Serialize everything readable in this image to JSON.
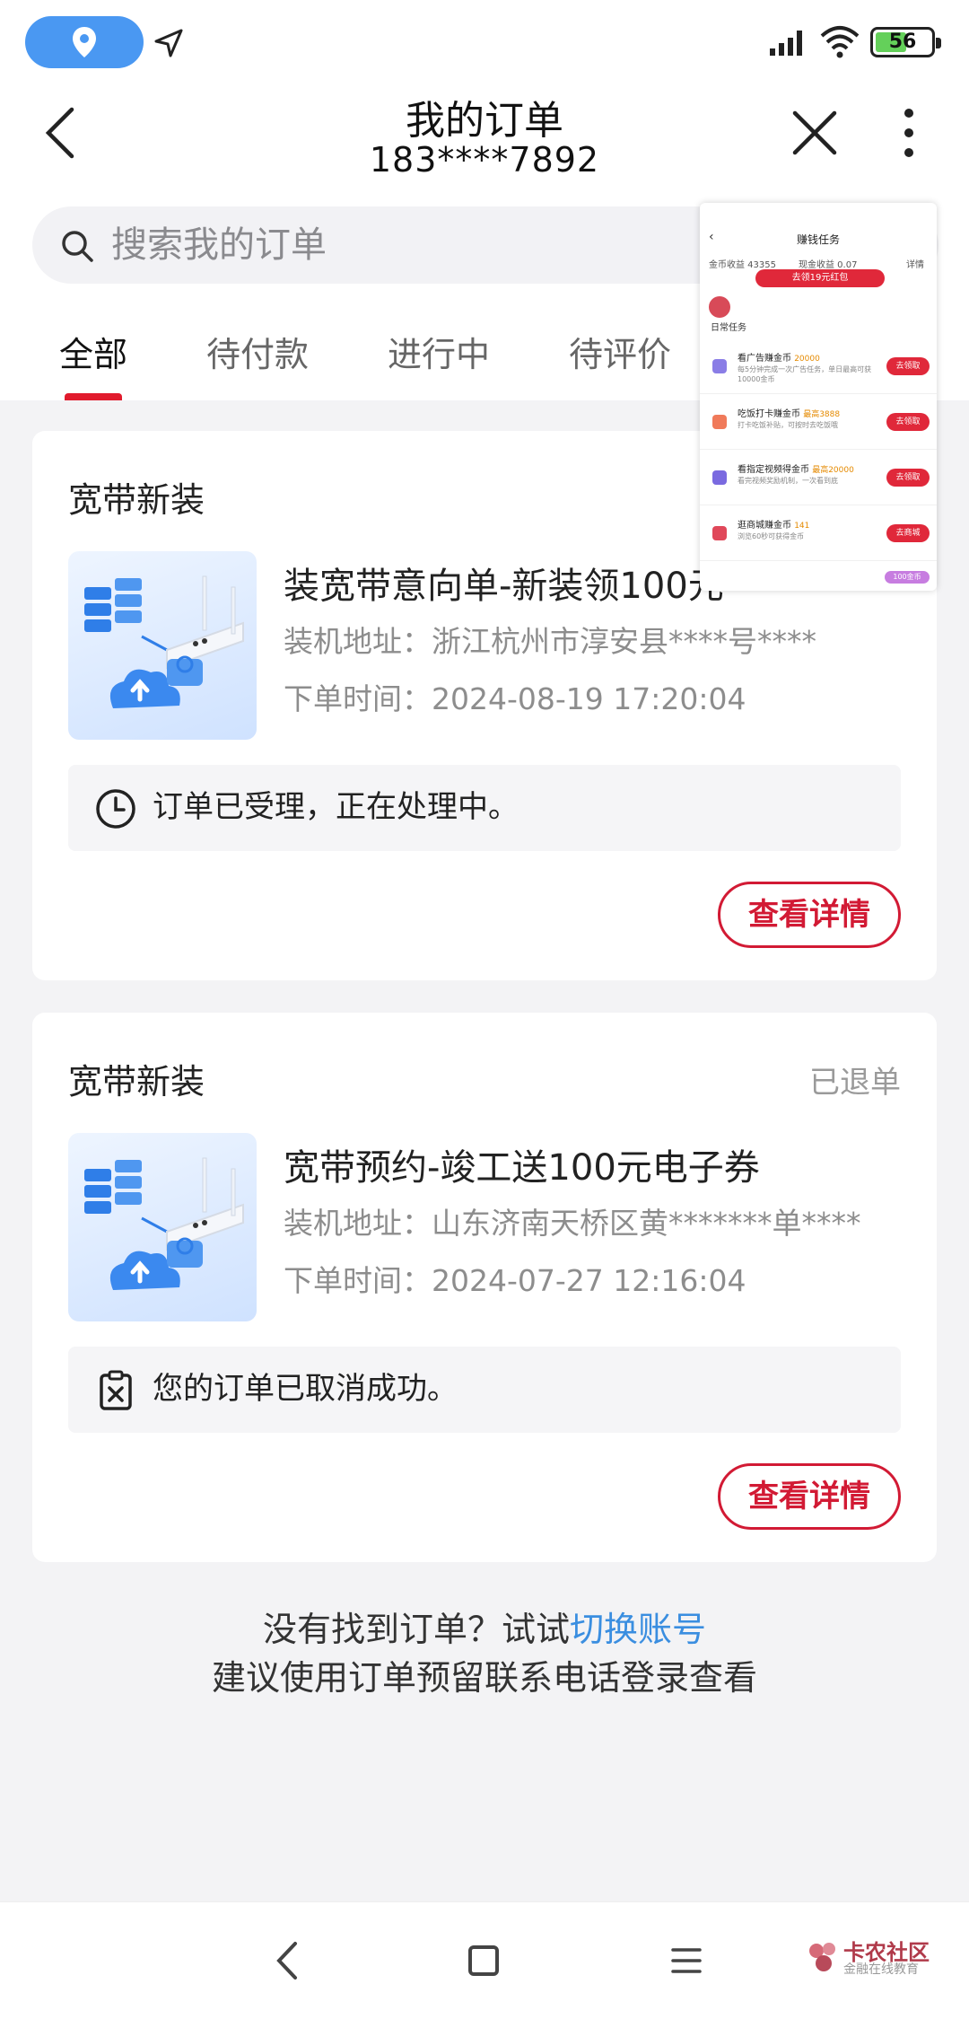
{
  "status_bar": {
    "battery": "56",
    "battery_level": 0.56
  },
  "header": {
    "title": "我的订单",
    "phone": "183****7892"
  },
  "search": {
    "placeholder": "搜索我的订单"
  },
  "tabs": [
    {
      "label": "全部",
      "active": true
    },
    {
      "label": "待付款",
      "active": false
    },
    {
      "label": "进行中",
      "active": false
    },
    {
      "label": "待评价",
      "active": false
    }
  ],
  "orders": [
    {
      "category": "宽带新装",
      "status": "",
      "product_name": "装宽带意向单-新装领100元",
      "address_label": "装机地址：",
      "address": "浙江杭州市淳安县****号****",
      "time_label": "下单时间：",
      "time": "2024-08-19 17:20:04",
      "notice": "订单已受理，正在处理中。",
      "notice_icon": "clock-icon",
      "detail_label": "查看详情"
    },
    {
      "category": "宽带新装",
      "status": "已退单",
      "product_name": "宽带预约-竣工送100元电子券",
      "address_label": "装机地址：",
      "address": "山东济南天桥区黄*******单****",
      "time_label": "下单时间：",
      "time": "2024-07-27 12:16:04",
      "notice": "您的订单已取消成功。",
      "notice_icon": "clipboard-x-icon",
      "detail_label": "查看详情"
    }
  ],
  "footer_hint": {
    "line1_prefix": "没有找到订单？试试",
    "line1_link": "切换账号",
    "line2": "建议使用订单预留联系电话登录查看"
  },
  "overlay": {
    "title": "赚钱任务",
    "coin_income": "金币收益 43355",
    "cash_income": "现金收益 0.07",
    "detail": "详情",
    "red_button": "去领19元红包",
    "section": "日常任务",
    "tasks": [
      {
        "title": "看广告赚金币",
        "reward": "20000",
        "desc": "每5分钟完成一次广告任务，单日最高可获10000金币",
        "button": "去领取",
        "color": "#8a7de6"
      },
      {
        "title": "吃饭打卡赚金币",
        "reward": "最高3888",
        "desc": "打卡吃饭补贴，可按时去吃饭哦",
        "button": "去领取",
        "color": "#f07a5a"
      },
      {
        "title": "看指定视频得金币",
        "reward": "最高20000",
        "desc": "看完视频奖励机制，一次看到底",
        "button": "去领取",
        "color": "#7a6ae0"
      },
      {
        "title": "逛商城赚金币",
        "reward": "141",
        "desc": "浏览60秒可获得金币",
        "button": "去商城",
        "color": "#e0485a"
      }
    ],
    "purple_tag": "100金币"
  },
  "watermark": {
    "line1": "卡农社区",
    "line2": "金融在线教育"
  },
  "colors": {
    "accent": "#d21a34",
    "link": "#3a8ee0",
    "status_blue": "#4a98f2"
  }
}
